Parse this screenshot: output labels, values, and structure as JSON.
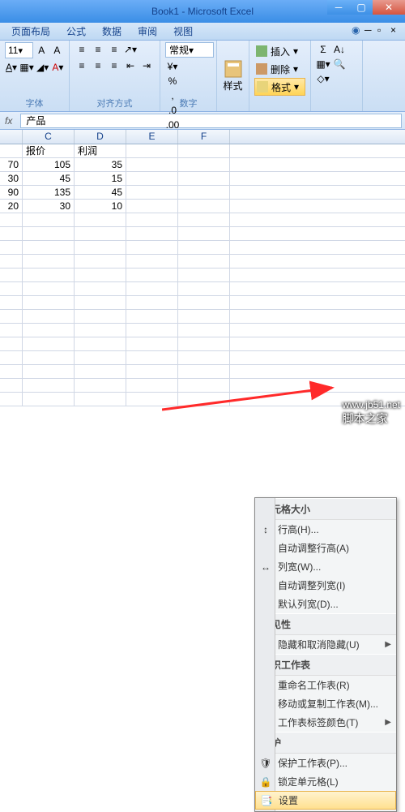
{
  "window": {
    "title": "Book1 - Microsoft Excel"
  },
  "tabs": [
    "页面布局",
    "公式",
    "数据",
    "审阅",
    "视图"
  ],
  "ribbon": {
    "font": {
      "size": "11",
      "group": "字体"
    },
    "align": {
      "group": "对齐方式"
    },
    "number": {
      "style": "常规",
      "group": "数字"
    },
    "styles": {
      "label": "样式"
    },
    "cells": {
      "insert": "插入",
      "delete": "删除",
      "format": "格式"
    },
    "edit": {
      "sigma": "Σ"
    }
  },
  "formula": {
    "value": "产品"
  },
  "cols": [
    "C",
    "D",
    "E",
    "F"
  ],
  "data": {
    "headers": [
      "报价",
      "利润"
    ],
    "rows": [
      [
        "70",
        "105",
        "35"
      ],
      [
        "30",
        "45",
        "15"
      ],
      [
        "90",
        "135",
        "45"
      ],
      [
        "20",
        "30",
        "10"
      ]
    ]
  },
  "menu": {
    "s1": "单元格大小",
    "rowh": "行高(H)...",
    "arowh": "自动调整行高(A)",
    "colw": "列宽(W)...",
    "acolw": "自动调整列宽(I)",
    "dcolw": "默认列宽(D)...",
    "s2": "可见性",
    "hide": "隐藏和取消隐藏(U)",
    "s3": "组织工作表",
    "rename": "重命名工作表(R)",
    "move": "移动或复制工作表(M)...",
    "tabcolor": "工作表标签颜色(T)",
    "s4": "保护",
    "protect": "保护工作表(P)...",
    "lock": "锁定单元格(L)",
    "set": "设置"
  },
  "watermark": {
    "url": "www.jb51.net",
    "cn": "脚本之家"
  }
}
